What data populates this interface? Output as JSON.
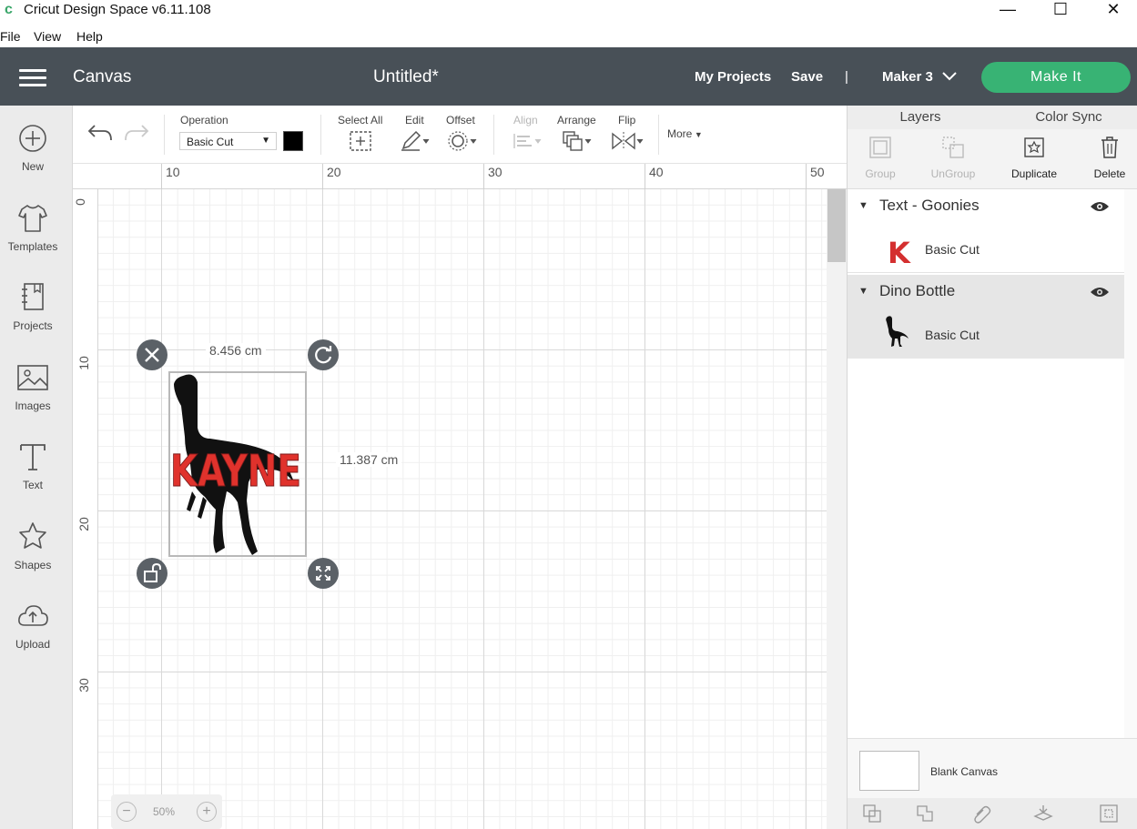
{
  "window": {
    "title": "Cricut Design Space  v6.11.108",
    "controls": {
      "minimize": "—",
      "maximize": "☐",
      "close": "✕"
    }
  },
  "menubar": [
    "File",
    "View",
    "Help"
  ],
  "header": {
    "section": "Canvas",
    "document_title": "Untitled*",
    "my_projects": "My Projects",
    "save": "Save",
    "separator": "|",
    "machine": "Maker 3",
    "make_it": "Make It"
  },
  "sidebar": {
    "items": [
      {
        "label": "New",
        "icon": "plus-circle-icon"
      },
      {
        "label": "Templates",
        "icon": "tshirt-icon"
      },
      {
        "label": "Projects",
        "icon": "notebook-icon"
      },
      {
        "label": "Images",
        "icon": "image-icon"
      },
      {
        "label": "Text",
        "icon": "text-t-icon"
      },
      {
        "label": "Shapes",
        "icon": "shapes-icon"
      },
      {
        "label": "Upload",
        "icon": "cloud-upload-icon"
      }
    ]
  },
  "toolbar": {
    "operation_label": "Operation",
    "operation_value": "Basic Cut",
    "operation_color": "#000000",
    "select_all": "Select All",
    "edit": "Edit",
    "offset": "Offset",
    "align": "Align",
    "arrange": "Arrange",
    "flip": "Flip",
    "more": "More"
  },
  "ruler": {
    "top": [
      "10",
      "20",
      "30",
      "40",
      "50"
    ],
    "left": [
      "0",
      "10",
      "20",
      "30"
    ]
  },
  "selection": {
    "width_label": "8.456 cm",
    "height_label": "11.387 cm",
    "text": "KAYNE"
  },
  "zoom": {
    "minus": "−",
    "value": "50%",
    "plus": "+"
  },
  "layers_panel": {
    "tabs": [
      "Layers",
      "Color Sync"
    ],
    "tools": [
      {
        "label": "Group",
        "enabled": false,
        "icon": "group-icon"
      },
      {
        "label": "UnGroup",
        "enabled": false,
        "icon": "ungroup-icon"
      },
      {
        "label": "Duplicate",
        "enabled": true,
        "icon": "duplicate-icon"
      },
      {
        "label": "Delete",
        "enabled": true,
        "icon": "trash-icon"
      }
    ],
    "groups": [
      {
        "title": "Text - Goonies",
        "operation": "Basic Cut",
        "thumb_color": "#d42f2f",
        "thumb_text": "K"
      },
      {
        "title": "Dino Bottle",
        "operation": "Basic Cut",
        "thumb_color": "#111111"
      }
    ],
    "blank_canvas": "Blank Canvas"
  },
  "colors": {
    "header_bg": "#485057",
    "make_it": "#38b374",
    "text_red": "#e0322c",
    "dino": "#111111"
  }
}
